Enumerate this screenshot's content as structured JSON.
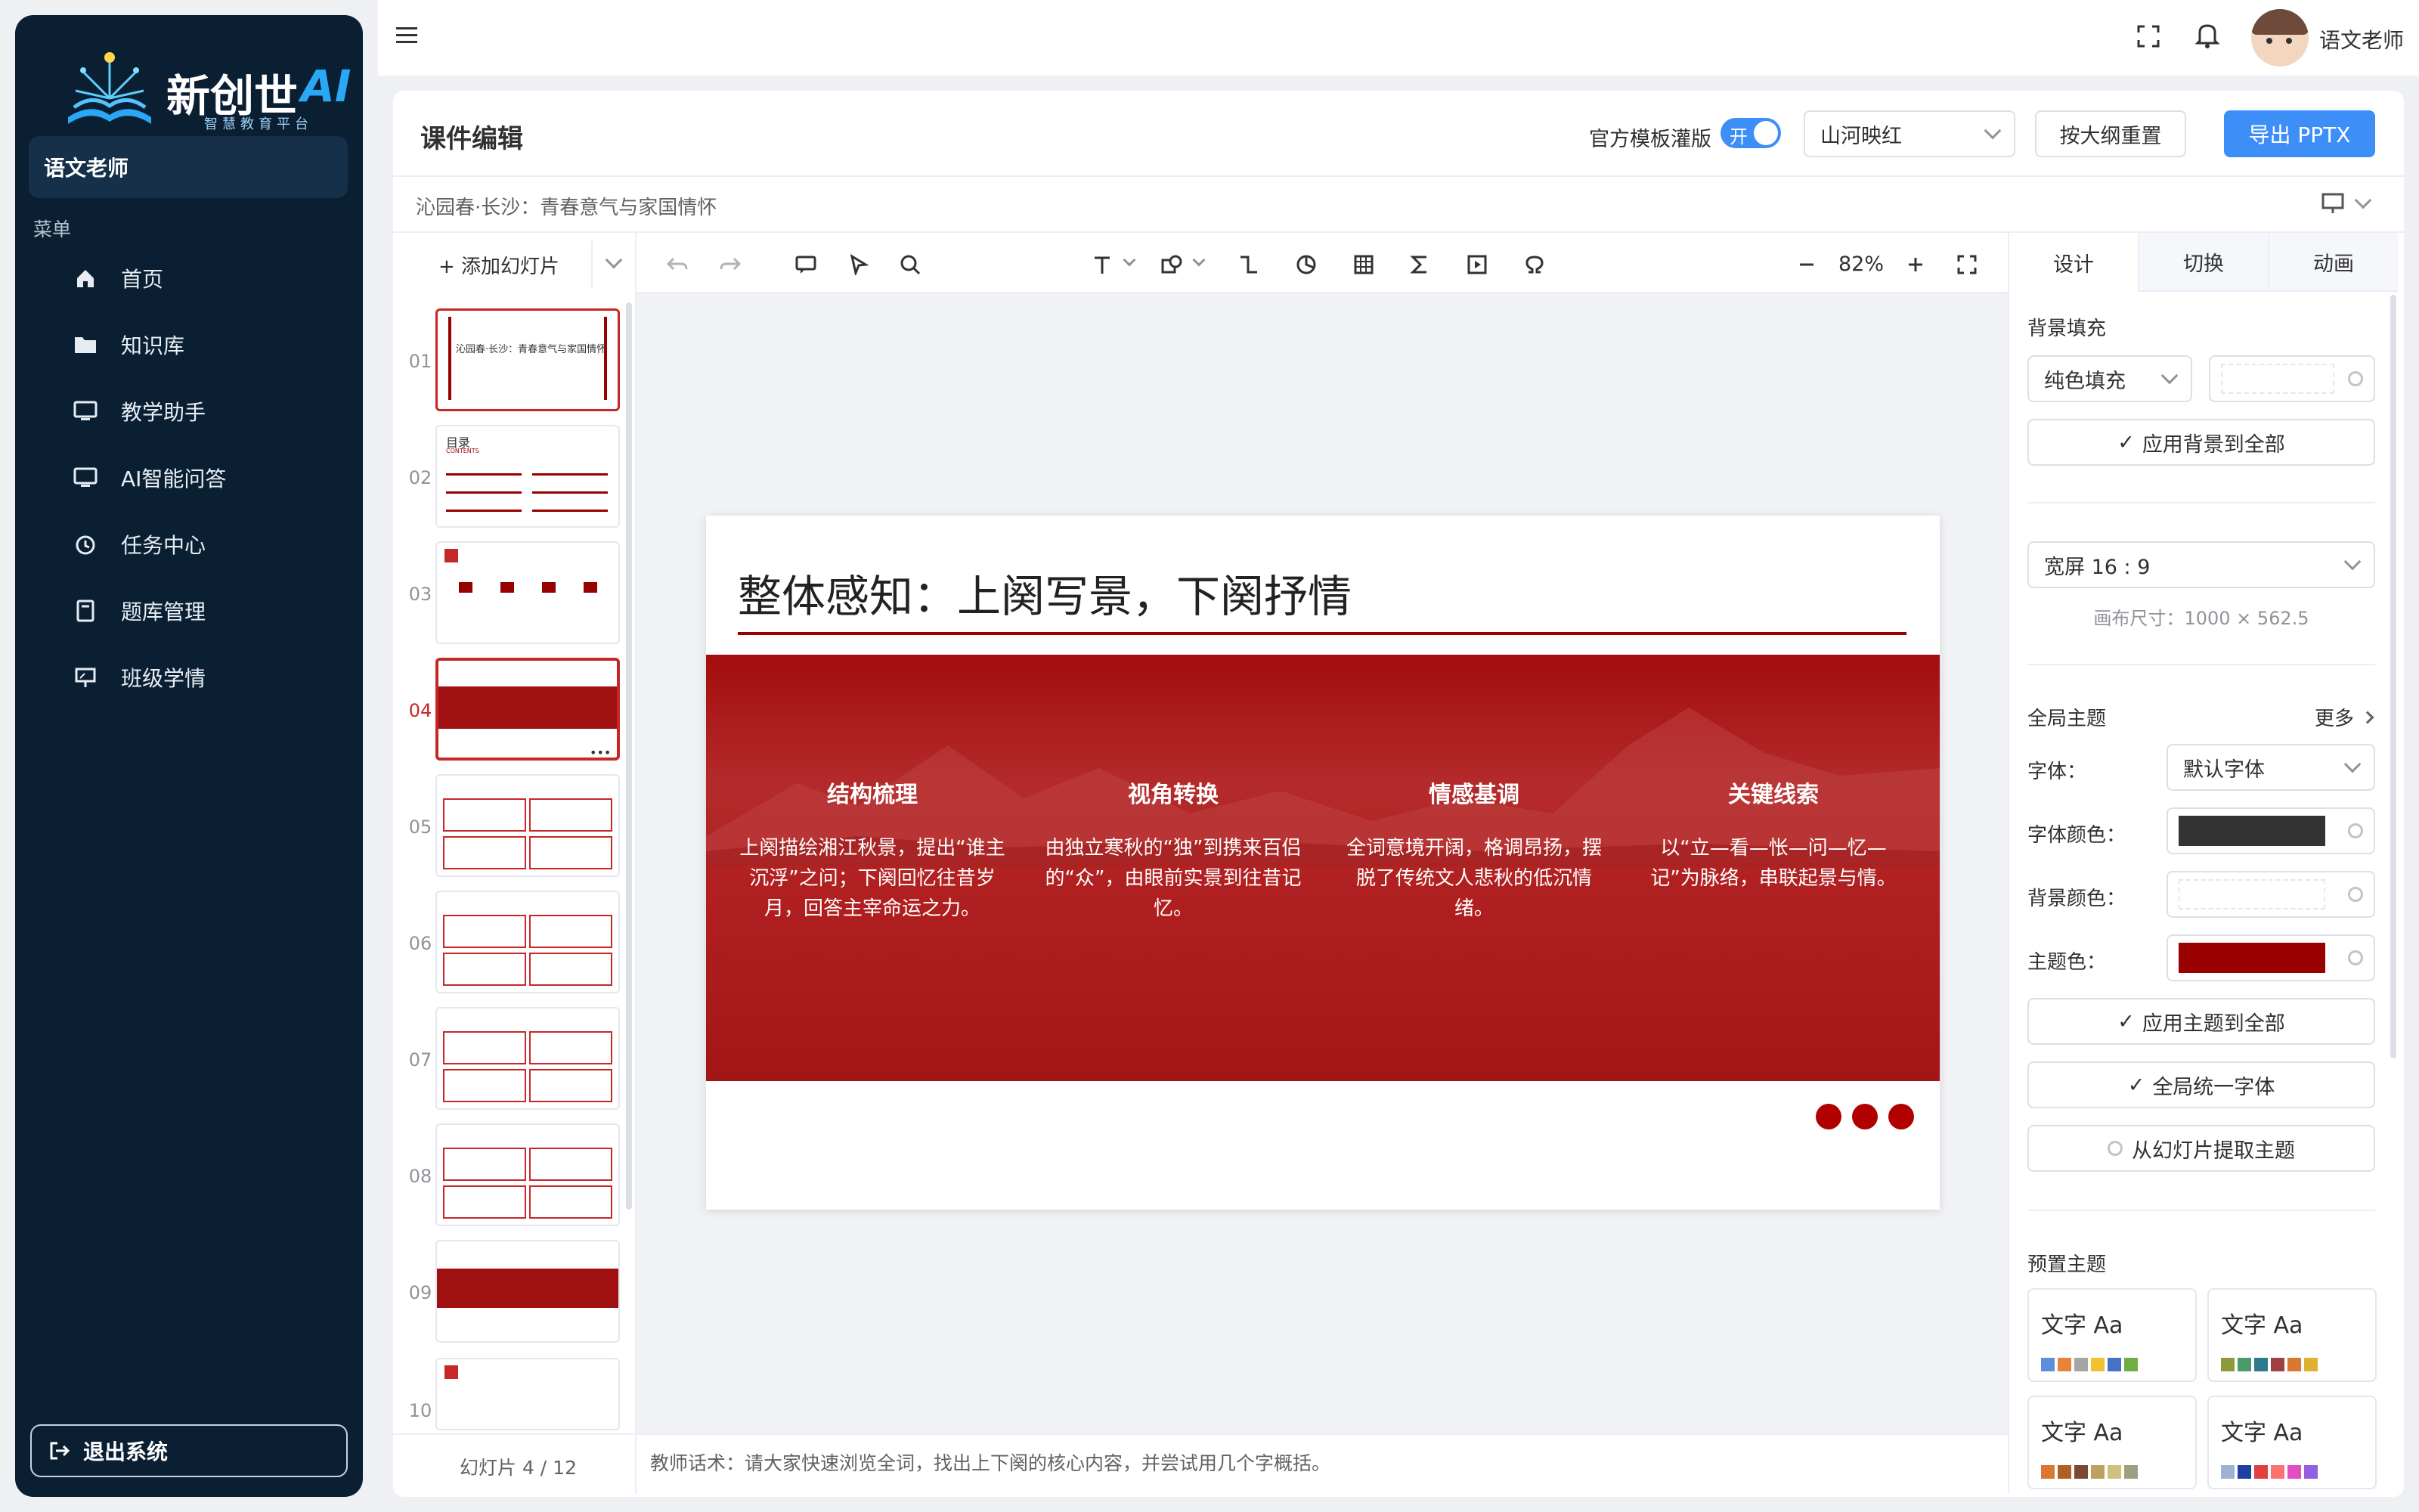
{
  "brand": {
    "name": "新创世",
    "ai": "AI",
    "tagline": "智慧教育平台"
  },
  "sidebar": {
    "user": "语文老师",
    "menu_label": "菜单",
    "items": [
      {
        "label": "首页",
        "icon": "home-icon"
      },
      {
        "label": "知识库",
        "icon": "folder-icon"
      },
      {
        "label": "教学助手",
        "icon": "monitor-icon"
      },
      {
        "label": "AI智能问答",
        "icon": "monitor-icon"
      },
      {
        "label": "任务中心",
        "icon": "alarm-clock-icon"
      },
      {
        "label": "题库管理",
        "icon": "book-icon"
      },
      {
        "label": "班级学情",
        "icon": "presentation-icon"
      }
    ],
    "logout": "退出系统"
  },
  "topbar": {
    "username": "语文老师"
  },
  "editor": {
    "title": "课件编辑",
    "template_toggle_label": "官方模板灌版",
    "toggle_on": "开",
    "theme_select": "山河映红",
    "reset_button": "按大纲重置",
    "export_button": "导出 PPTX",
    "doc_title": "沁园春·长沙：青春意气与家国情怀"
  },
  "toolbar": {
    "add_slide": "+ 添加幻灯片",
    "zoom": "82%"
  },
  "thumbnails": [
    "01",
    "02",
    "03",
    "04",
    "05",
    "06",
    "07",
    "08",
    "09",
    "10"
  ],
  "thumb_titles": {
    "t1": "沁园春·长沙：青春意气与家国情怀",
    "t2": "目录",
    "t2_sub": "CONTENTS"
  },
  "slide_counter": "幻灯片 4 / 12",
  "active_slide_num": "04",
  "slide": {
    "title": "整体感知：上阕写景，下阕抒情",
    "columns": [
      {
        "heading": "结构梳理",
        "text": "上阕描绘湘江秋景，提出“谁主沉浮”之问；下阕回忆往昔岁月，回答主宰命运之力。"
      },
      {
        "heading": "视角转换",
        "text": "由独立寒秋的“独”到携来百侣的“众”，由眼前实景到往昔记忆。"
      },
      {
        "heading": "情感基调",
        "text": "全词意境开阔，格调昂扬，摆脱了传统文人悲秋的低沉情绪。"
      },
      {
        "heading": "关键线索",
        "text": "以“立—看—怅—问—忆—记”为脉络，串联起景与情。"
      }
    ]
  },
  "notes": "教师话术：请大家快速浏览全词，找出上下阕的核心内容，并尝试用几个字概括。",
  "panel": {
    "tabs": [
      "设计",
      "切换",
      "动画"
    ],
    "bg_fill_label": "背景填充",
    "bg_fill_select": "纯色填充",
    "apply_bg_all": "应用背景到全部",
    "aspect_select": "宽屏 16 : 9",
    "canvas_size": "画布尺寸：1000 × 562.5",
    "global_theme": "全局主题",
    "more": "更多",
    "font_label": "字体：",
    "font_select": "默认字体",
    "font_color_label": "字体颜色：",
    "bg_color_label": "背景颜色：",
    "theme_color_label": "主题色：",
    "apply_theme_all": "应用主题到全部",
    "unify_font": "全局统一字体",
    "extract_theme": "从幻灯片提取主题",
    "preset_label": "预置主题",
    "preset_sample": "文字 Aa"
  },
  "colors": {
    "theme": "#990000",
    "font": "#333333",
    "accent": "#3e8ef7"
  },
  "presets": [
    [
      "#5b8fd9",
      "#e8833a",
      "#a5a5a5",
      "#f2c22e",
      "#4472c4",
      "#70ad47"
    ],
    [
      "#8e9a3a",
      "#4a9a6a",
      "#2f7a8a",
      "#a04040",
      "#d9782e",
      "#e0b030"
    ],
    [
      "#d9782e",
      "#b06020",
      "#7a4a30",
      "#c0a060",
      "#d0c080",
      "#a0a080"
    ],
    [
      "#a0b0d0",
      "#2040a0",
      "#e04040",
      "#ff7070",
      "#e050c0",
      "#9060e0"
    ]
  ]
}
